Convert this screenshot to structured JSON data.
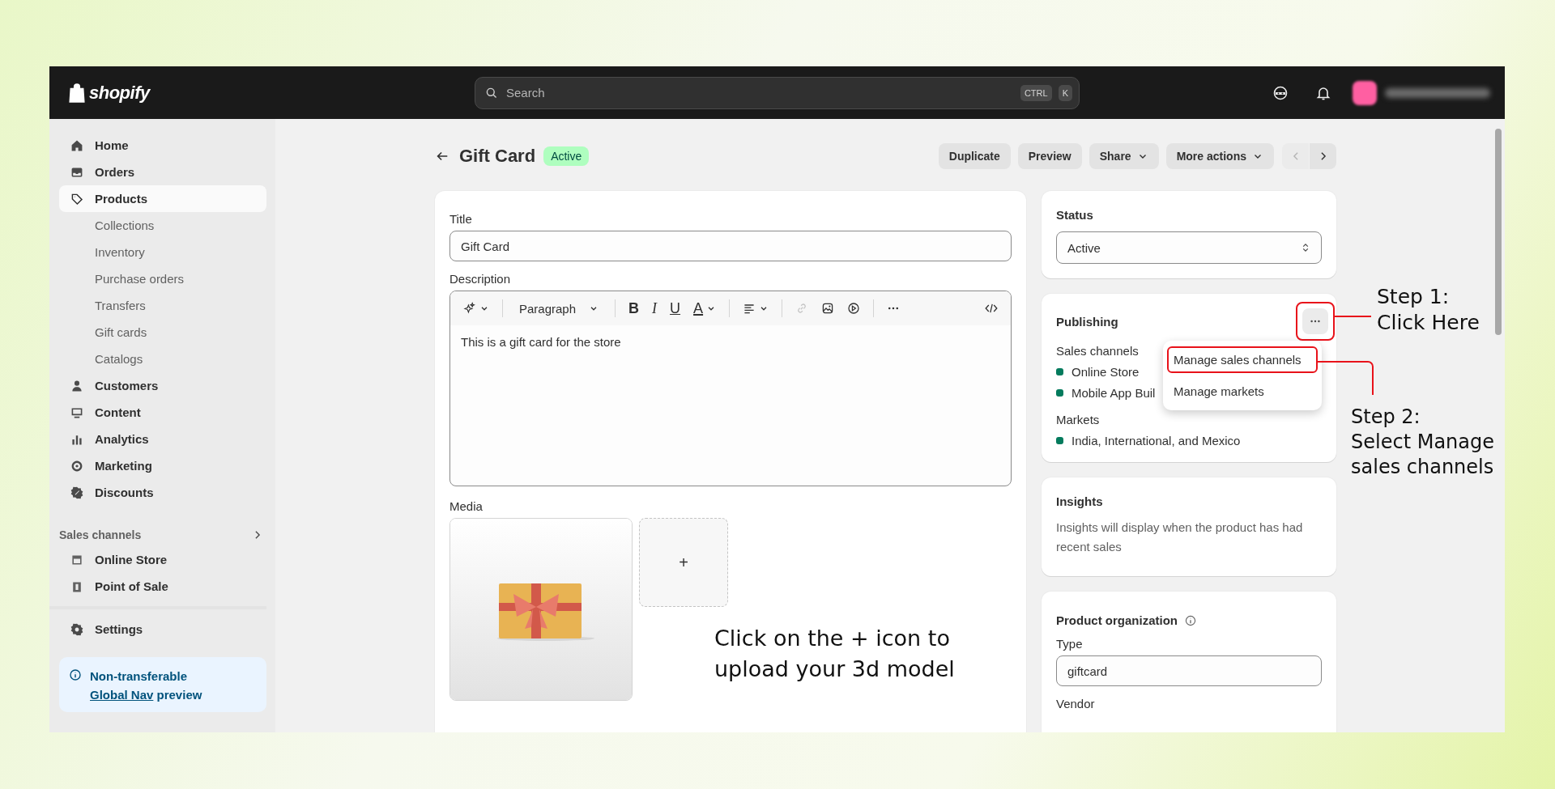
{
  "topbar": {
    "logo": "shopify",
    "search_placeholder": "Search",
    "shortcut_keys": [
      "CTRL",
      "K"
    ]
  },
  "sidebar": {
    "items": [
      {
        "label": "Home",
        "kind": "home",
        "selected": false
      },
      {
        "label": "Orders",
        "kind": "orders",
        "selected": false
      },
      {
        "label": "Products",
        "kind": "tag",
        "selected": true,
        "children": [
          {
            "label": "Collections",
            "selected": false
          },
          {
            "label": "Inventory",
            "selected": false
          },
          {
            "label": "Purchase orders",
            "selected": false
          },
          {
            "label": "Transfers",
            "selected": false
          },
          {
            "label": "Gift cards",
            "selected": false
          },
          {
            "label": "Catalogs",
            "selected": false
          }
        ]
      },
      {
        "label": "Customers",
        "kind": "customers",
        "selected": false
      },
      {
        "label": "Content",
        "kind": "content",
        "selected": false
      },
      {
        "label": "Analytics",
        "kind": "analytics",
        "selected": false
      },
      {
        "label": "Marketing",
        "kind": "marketing",
        "selected": false
      },
      {
        "label": "Discounts",
        "kind": "discounts",
        "selected": false
      }
    ],
    "sales_channels": {
      "heading": "Sales channels",
      "items": [
        {
          "label": "Online Store",
          "kind": "store",
          "selected": false
        },
        {
          "label": "Point of Sale",
          "kind": "pos",
          "selected": false
        }
      ]
    },
    "bottom_items": [
      {
        "label": "Settings",
        "kind": "gear",
        "selected": false
      }
    ],
    "notice": {
      "before": "Non-transferable",
      "link": "Global Nav",
      "after": "preview"
    }
  },
  "header": {
    "title": "Gift Card",
    "badge": "Active",
    "actions": [
      {
        "label": "Duplicate",
        "dropdown": false
      },
      {
        "label": "Preview",
        "dropdown": false
      },
      {
        "label": "Share",
        "dropdown": true
      },
      {
        "label": "More actions",
        "dropdown": true
      }
    ],
    "pager": {
      "prev_disabled": true,
      "next_disabled": false
    }
  },
  "details": {
    "title_label": "Title",
    "title_value": "Gift Card",
    "description_label": "Description",
    "toolbar": {
      "format": "Paragraph",
      "marks": [
        {
          "label": "B",
          "kind": "bold"
        },
        {
          "label": "I",
          "kind": "italic"
        },
        {
          "label": "U",
          "kind": "underline"
        },
        {
          "label": "A",
          "kind": "color"
        }
      ],
      "link_disabled": true
    },
    "description": "This is a gift card for the store",
    "media_label": "Media",
    "add_media": "+"
  },
  "status": {
    "label": "Status",
    "value": "Active"
  },
  "publishing": {
    "title": "Publishing",
    "more_highlighted": true,
    "channels_heading": "Sales channels",
    "channels": [
      {
        "name": "Online Store",
        "color": "#047b5d"
      },
      {
        "name": "Mobile App Buil",
        "color": "#047b5d"
      }
    ],
    "markets_heading": "Markets",
    "markets": [
      {
        "name": "India, International, and Mexico",
        "color": "#047b5d"
      }
    ],
    "menu": [
      {
        "label": "Manage sales channels",
        "highlighted": true
      },
      {
        "label": "Manage markets",
        "highlighted": false
      }
    ]
  },
  "insights": {
    "title": "Insights",
    "text": "Insights will display when the product has had recent sales"
  },
  "organization": {
    "title": "Product organization",
    "type_label": "Type",
    "type_value": "giftcard",
    "vendor_label": "Vendor"
  },
  "annotations": {
    "step_1": [
      "Step 1:",
      "Click Here"
    ],
    "step_2": [
      "Step 2:",
      "Select Manage",
      "sales channels"
    ],
    "hint": [
      "Click on the + icon to",
      "upload your 3d model"
    ]
  }
}
